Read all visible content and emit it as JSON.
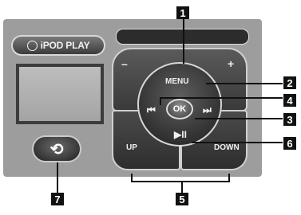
{
  "ipod_play_label": "iPOD PLAY",
  "controls": {
    "minus": "–",
    "plus": "+",
    "menu": "MENU",
    "prev": "⏮",
    "ok": "OK",
    "next": "⏭",
    "play_pause": "▶II",
    "up": "UP",
    "down": "DOWN",
    "back": "⟲"
  },
  "callouts": {
    "c1": "1",
    "c2": "2",
    "c3": "3",
    "c4": "4",
    "c5": "5",
    "c6": "6",
    "c7": "7"
  }
}
